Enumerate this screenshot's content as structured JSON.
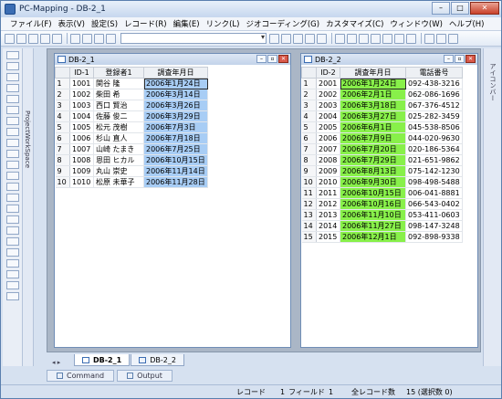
{
  "window": {
    "title": "PC-Mapping - DB-2_1"
  },
  "menu": [
    "ファイル(F)",
    "表示(V)",
    "設定(S)",
    "レコード(R)",
    "編集(E)",
    "リンク(L)",
    "ジオコーディング(G)",
    "カスタマイズ(C)",
    "ウィンドウ(W)",
    "ヘルプ(H)"
  ],
  "left_panel": {
    "label": "ProjectWorkSpace"
  },
  "right_panel": {
    "label": "アイコンバー"
  },
  "db1": {
    "title": "DB-2_1",
    "columns": [
      "ID-1",
      "登録者1",
      "調査年月日"
    ],
    "rows": [
      [
        "1",
        "1001",
        "関谷 隆",
        "2006年1月24日"
      ],
      [
        "2",
        "1002",
        "柴田 希",
        "2006年3月14日"
      ],
      [
        "3",
        "1003",
        "西口 賢治",
        "2006年3月26日"
      ],
      [
        "4",
        "1004",
        "佐藤 俊二",
        "2006年3月29日"
      ],
      [
        "5",
        "1005",
        "松元 茂樹",
        "2006年7月3日"
      ],
      [
        "6",
        "1006",
        "杉山 直人",
        "2006年7月18日"
      ],
      [
        "7",
        "1007",
        "山崎 たまき",
        "2006年7月25日"
      ],
      [
        "8",
        "1008",
        "恩田 ヒカル",
        "2006年10月15日"
      ],
      [
        "9",
        "1009",
        "丸山 崇史",
        "2006年11月14日"
      ],
      [
        "10",
        "1010",
        "松原 未華子",
        "2006年11月28日"
      ]
    ]
  },
  "db2": {
    "title": "DB-2_2",
    "columns": [
      "ID-2",
      "調査年月日",
      "電話番号"
    ],
    "rows": [
      [
        "1",
        "2001",
        "2006年1月24日",
        "092-438-3216"
      ],
      [
        "2",
        "2002",
        "2006年2月1日",
        "062-086-1696"
      ],
      [
        "3",
        "2003",
        "2006年3月18日",
        "067-376-4512"
      ],
      [
        "4",
        "2004",
        "2006年3月27日",
        "025-282-3459"
      ],
      [
        "5",
        "2005",
        "2006年6月1日",
        "045-538-8506"
      ],
      [
        "6",
        "2006",
        "2006年7月9日",
        "044-020-9630"
      ],
      [
        "7",
        "2007",
        "2006年7月20日",
        "020-186-5364"
      ],
      [
        "8",
        "2008",
        "2006年7月29日",
        "021-651-9862"
      ],
      [
        "9",
        "2009",
        "2006年8月13日",
        "075-142-1230"
      ],
      [
        "10",
        "2010",
        "2006年9月30日",
        "098-498-5488"
      ],
      [
        "11",
        "2011",
        "2006年10月15日",
        "006-041-8881"
      ],
      [
        "12",
        "2012",
        "2006年10月16日",
        "066-543-0402"
      ],
      [
        "13",
        "2013",
        "2006年11月10日",
        "053-411-0603"
      ],
      [
        "14",
        "2014",
        "2006年11月27日",
        "098-147-3248"
      ],
      [
        "15",
        "2015",
        "2006年12月1日",
        "092-898-9338"
      ]
    ]
  },
  "mdi_tabs": [
    "DB-2_1",
    "DB-2_2"
  ],
  "bottom_tabs": [
    "Command",
    "Output"
  ],
  "status": {
    "record_label": "レコード",
    "record_value": "1",
    "field_label": "フィールド",
    "field_value": "1",
    "total_label": "全レコード数",
    "total_value": "15 (選択数 0)"
  },
  "colors": {
    "date_col_db1": "#a8cdf5",
    "date_col_db2": "#88f04a"
  }
}
